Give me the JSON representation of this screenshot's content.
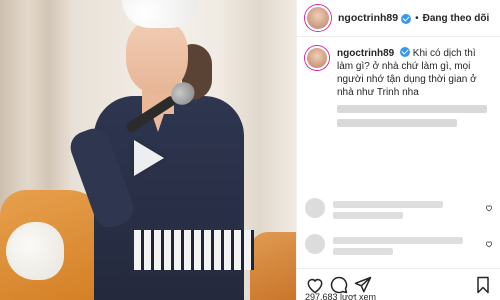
{
  "post": {
    "username": "ngoctrinh89",
    "follow_label": "Đang theo dõi",
    "separator": "•",
    "caption": {
      "username": "ngoctrinh89",
      "text": "Khi có dịch thì làm gì? ở nhà chứ làm gì, mọi người nhớ tận dụng thời gian ở nhà như Trinh nha"
    },
    "views_text": "297.683 lượt xem"
  },
  "icons": {
    "like": "heart-icon",
    "comment": "comment-icon",
    "share": "paper-plane-icon",
    "save": "bookmark-icon",
    "play": "play-icon",
    "verified": "verified-badge-icon"
  },
  "colors": {
    "verified_blue": "#3897f0",
    "story_ring": "#d6249f",
    "text_primary": "#262626"
  }
}
